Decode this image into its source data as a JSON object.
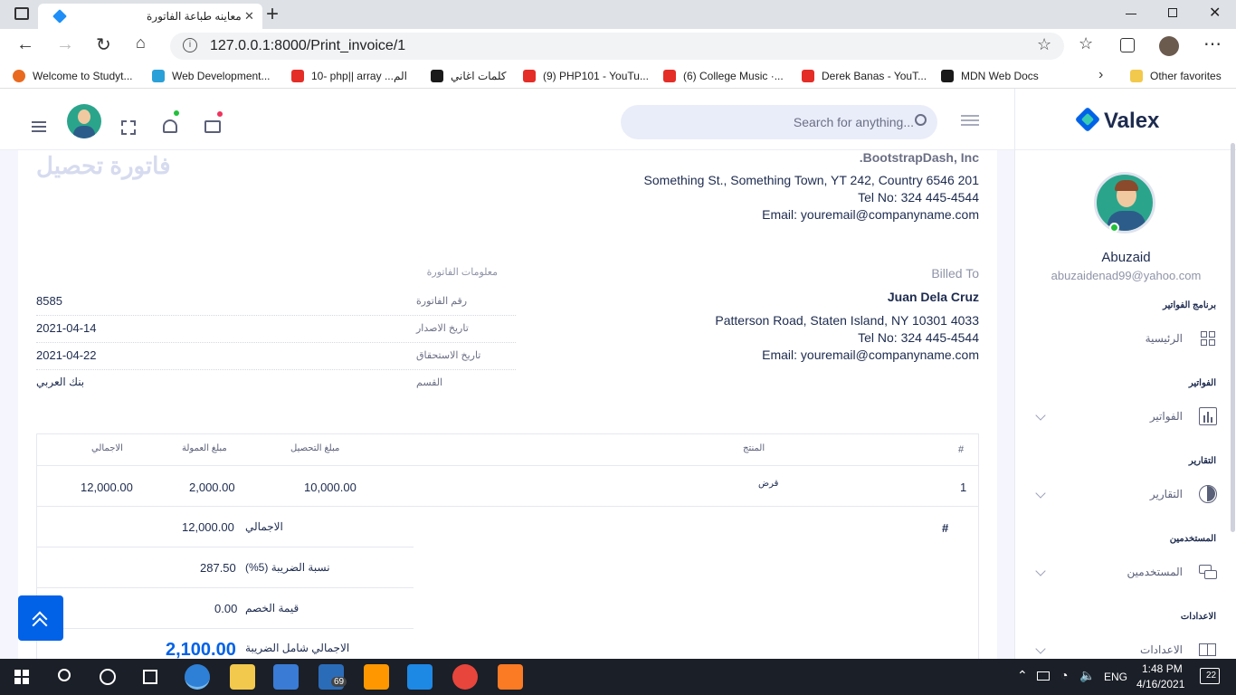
{
  "browser": {
    "tab_title": "معاينه طباعة الفاتورة",
    "close_tab": "✕",
    "new_tab": "+",
    "url": "127.0.0.1:8000/Print_invoice/1",
    "favorites": [
      {
        "label": "Welcome to Studyt...",
        "color": "#e96a1f"
      },
      {
        "label": "Web Development...",
        "color": "#2aa0d8"
      },
      {
        "label": "10- php|| array ...الم",
        "color": "#e52d27"
      },
      {
        "label": "كلمات اغاني",
        "color": "#1a1a1a"
      },
      {
        "label": "(9) PHP101 - YouTu...",
        "color": "#e52d27"
      },
      {
        "label": "(6) College Music ·...",
        "color": "#e52d27"
      },
      {
        "label": "Derek Banas - YouT...",
        "color": "#e52d27"
      },
      {
        "label": "MDN Web Docs",
        "color": "#1a1a1a"
      }
    ],
    "other_favorites": "Other favorites"
  },
  "header": {
    "search_placeholder": "Search for anything..."
  },
  "sidebar": {
    "brand": "Valex",
    "user_name": "Abuzaid",
    "user_email": "abuzaidenad99@yahoo.com",
    "sections": [
      {
        "label": "برنامج الفواتير",
        "item": "الرئيسية"
      },
      {
        "label": "الفواتير",
        "item": "الفواتير"
      },
      {
        "label": "التقارير",
        "item": "التقارير"
      },
      {
        "label": "المستخدمين",
        "item": "المستخدمين"
      },
      {
        "label": "الاعدادات",
        "item": "الاعدادات"
      }
    ]
  },
  "invoice": {
    "title": "فاتورة تحصيل",
    "company": {
      "name": "BootstrapDash, Inc.",
      "address": "Something St., Something Town, YT 242, Country 6546 201",
      "tel": "Tel No: 324 445-4544",
      "email": "Email: youremail@companyname.com"
    },
    "billed_to_label": "Billed To",
    "billed_to": {
      "name": "Juan Dela Cruz",
      "address": "Patterson Road, Staten Island, NY 10301 4033",
      "tel": "Tel No: 324 445-4544",
      "email": "Email: youremail@companyname.com"
    },
    "info_heading": "معلومات الفاتورة",
    "info_rows": [
      {
        "label": "رقم الفاتورة",
        "value": "8585"
      },
      {
        "label": "تاريخ الاصدار",
        "value": "2021-04-14"
      },
      {
        "label": "تاريخ الاستحقاق",
        "value": "2021-04-22"
      },
      {
        "label": "القسم",
        "value": "بنك العربي"
      }
    ],
    "table_headers": {
      "num": "#",
      "product": "المنتج",
      "collection": "مبلغ التحصيل",
      "commission": "مبلغ العمولة",
      "total": "الاجمالي"
    },
    "table_row": {
      "num": "1",
      "product": "قرض",
      "collection": "10,000.00",
      "commission": "2,000.00",
      "total": "12,000.00"
    },
    "summary_hash": "#",
    "summary": [
      {
        "label": "الاجمالي",
        "value": "12,000.00"
      },
      {
        "label": "نسبة الضريبة (5%)",
        "value": "287.50"
      },
      {
        "label": "قيمة الخصم",
        "value": "0.00"
      },
      {
        "label": "الاجمالي شامل الضريبة",
        "value": "2,100.00"
      }
    ]
  },
  "taskbar": {
    "time": "1:48 PM",
    "date": "4/16/2021",
    "lang": "ENG",
    "mail_badge": "69",
    "notif_count": "22"
  }
}
